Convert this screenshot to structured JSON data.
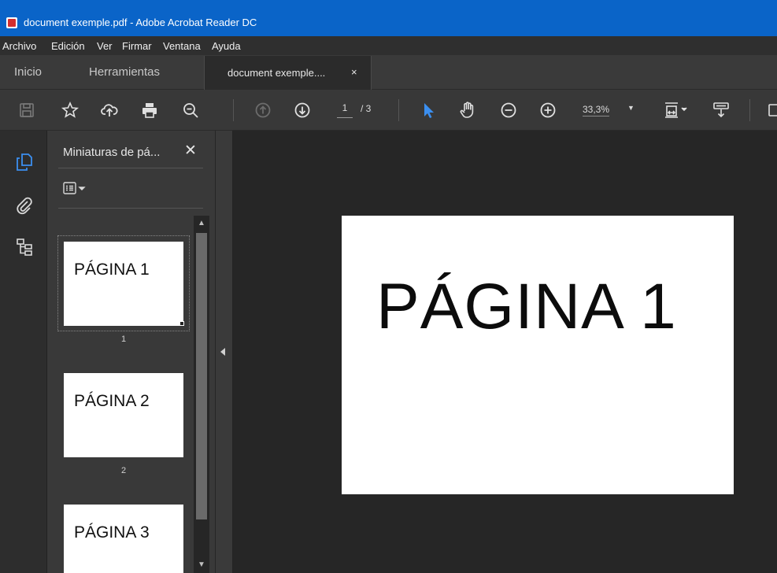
{
  "window": {
    "title": "document exemple.pdf - Adobe Acrobat Reader DC",
    "app_icon": "acrobat-pdf-icon"
  },
  "menubar": {
    "items": [
      "Archivo",
      "Edición",
      "Ver",
      "Firmar",
      "Ventana",
      "Ayuda"
    ]
  },
  "tabs": {
    "home": "Inicio",
    "tools": "Herramientas",
    "document": "document exemple....",
    "close_glyph": "×"
  },
  "toolbar": {
    "icons": [
      "save-icon",
      "bookmark-star-icon",
      "upload-cloud-icon",
      "print-icon",
      "search-zoom-icon",
      "prev-page-icon",
      "next-page-icon",
      "select-cursor-icon",
      "hand-tool-icon",
      "zoom-out-icon",
      "zoom-in-icon",
      "fit-page-icon",
      "scroll-mode-icon"
    ],
    "page_current": "1",
    "page_total": "/ 3",
    "zoom": "33,3%",
    "zoom_caret": "▼"
  },
  "sidebar_rail": {
    "icons": [
      "page-thumbnails-icon",
      "attachments-icon",
      "bookmarks-tree-icon"
    ]
  },
  "thumbnails_panel": {
    "title": "Miniaturas de pá...",
    "close": "✕",
    "options_caret": "▾",
    "pages": [
      {
        "text": "PÁGINA 1",
        "number": "1"
      },
      {
        "text": "PÁGINA 2",
        "number": "2"
      },
      {
        "text": "PÁGINA 3",
        "number": ""
      }
    ],
    "scroll_up": "▲",
    "scroll_down": "▼"
  },
  "document_view": {
    "page_text": "PÁGINA 1"
  },
  "colors": {
    "titlebar": "#0a64c8",
    "accent_blue": "#3b8ff0",
    "toolbar_bg": "#383838",
    "viewer_bg": "#262626"
  }
}
